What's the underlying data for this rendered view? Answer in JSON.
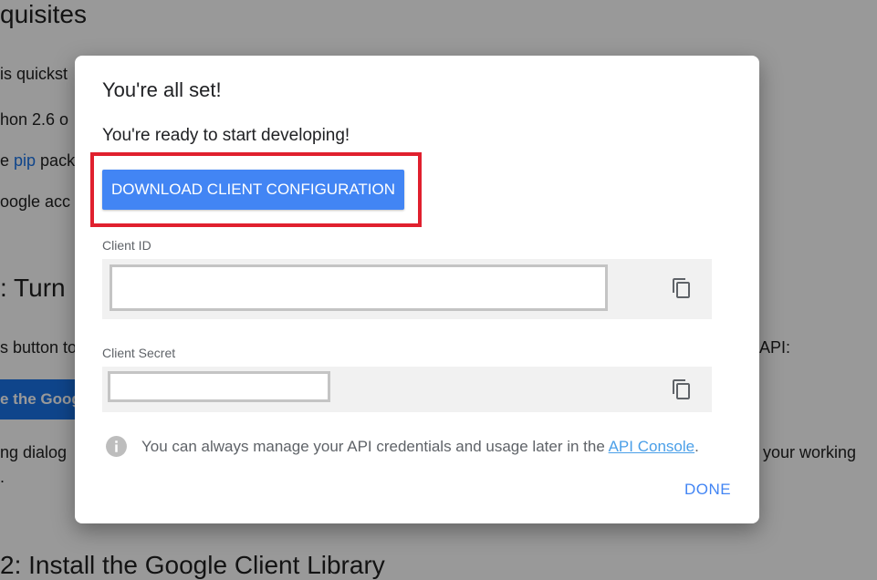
{
  "background": {
    "heading_prerequisites": "quisites",
    "line_quickstart": "is quickst",
    "line_python": "hon 2.6 o",
    "line_pip_prefix": "e ",
    "line_pip_link": "pip",
    "line_pip_suffix": " pack",
    "line_google": "oogle acc",
    "heading_turn": ": Turn",
    "line_button": "s button to",
    "line_api": "API:",
    "button_label": "e the Goog",
    "line_dialog": "ng dialog",
    "line_working": "your working",
    "line_dot": ".",
    "heading_install": "2: Install the Google Client Library"
  },
  "dialog": {
    "title": "You're all set!",
    "subtitle": "You're ready to start developing!",
    "download_button": "DOWNLOAD CLIENT CONFIGURATION",
    "client_id_label": "Client ID",
    "client_id_value": "",
    "client_secret_label": "Client Secret",
    "client_secret_value": "",
    "info_text": "You can always manage your API credentials and usage later in the ",
    "info_link": "API Console",
    "info_suffix": ".",
    "done_button": "DONE"
  },
  "colors": {
    "primary": "#4285f4",
    "highlight_border": "#e0202e",
    "link": "#4a9fe8"
  },
  "icons": {
    "copy": "copy-icon",
    "info": "info-icon"
  }
}
